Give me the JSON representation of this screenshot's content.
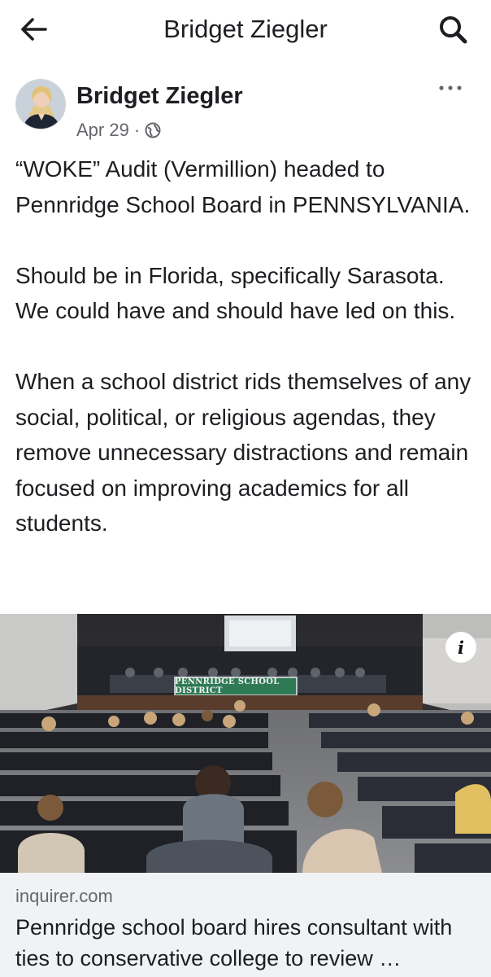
{
  "header": {
    "title": "Bridget Ziegler",
    "back_icon": "arrow-left-icon",
    "search_icon": "search-icon"
  },
  "post": {
    "author": "Bridget Ziegler",
    "date": "Apr 29",
    "separator": "·",
    "privacy_icon": "globe-icon",
    "more_icon": "more-horizontal-icon",
    "paragraphs": [
      "“WOKE” Audit (Vermillion) headed to Pennridge School Board in PENNSYLVANIA.",
      "Should be in Florida, specifically Sarasota. We could have and should have led on this.",
      "When a school district rids themselves of any social, political, or religious agendas, they remove unnecessary distractions and remain focused on improving academics for all students."
    ]
  },
  "link_card": {
    "banner_text": "PENNRIDGE SCHOOL DISTRICT",
    "info_label": "i",
    "domain": "inquirer.com",
    "title": "Pennridge school board hires consultant with ties to conservative college to review …"
  },
  "colors": {
    "text": "#1c1e21",
    "secondary": "#65676b",
    "card_bg": "#f0f2f5",
    "banner_green": "#2f7a55"
  }
}
